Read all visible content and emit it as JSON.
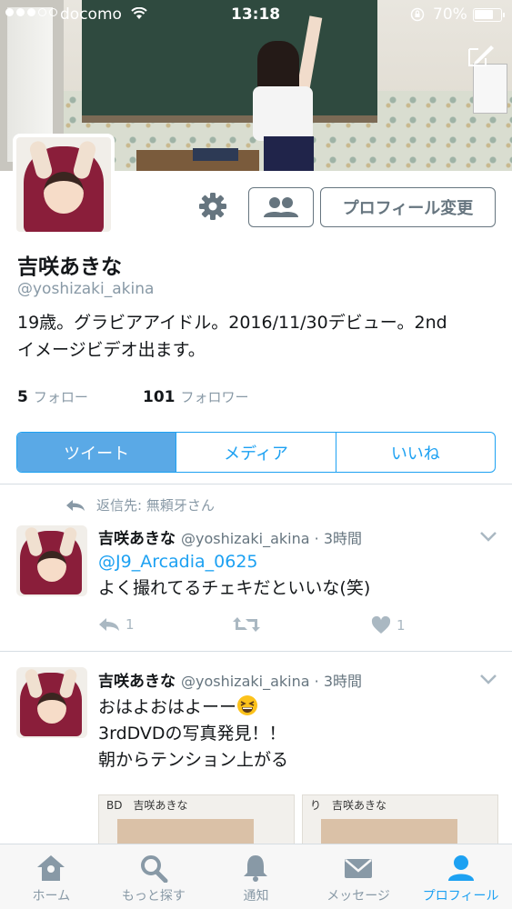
{
  "status_bar": {
    "carrier": "docomo",
    "time": "13:18",
    "battery": "70%"
  },
  "profile": {
    "display_name": "吉咲あきな",
    "handle": "@yoshizaki_akina",
    "bio_line1": "19歳。グラビアアイドル。2016/11/30デビュー。2nd",
    "bio_line2": "イメージビデオ出ます。",
    "following_count": "5",
    "following_label": "フォロー",
    "followers_count": "101",
    "followers_label": "フォロワー",
    "edit_button": "プロフィール変更"
  },
  "tabs": [
    {
      "label": "ツイート",
      "active": true
    },
    {
      "label": "メディア",
      "active": false
    },
    {
      "label": "いいね",
      "active": false
    }
  ],
  "tweets": [
    {
      "reply_context": "返信先: 無頼牙さん",
      "name": "吉咲あきな",
      "meta": "@yoshizaki_akina · 3時間",
      "mention": "@J9_Arcadia_0625",
      "text": "よく撮れてるチェキだといいな(笑)",
      "reply_count": "1",
      "like_count": "1"
    },
    {
      "name": "吉咲あきな",
      "meta": "@yoshizaki_akina · 3時間",
      "line1": "おはよおはよーー",
      "line2": "3rdDVDの写真発見！！",
      "line3": "朝からテンション上がる",
      "media": [
        {
          "caption": "BD　吉咲あきな"
        },
        {
          "caption": "り　吉咲あきな"
        }
      ]
    }
  ],
  "tab_bar": [
    {
      "label": "ホーム",
      "icon": "home-icon",
      "active": false
    },
    {
      "label": "もっと探す",
      "icon": "search-icon",
      "active": false
    },
    {
      "label": "通知",
      "icon": "bell-icon",
      "active": false
    },
    {
      "label": "メッセージ",
      "icon": "envelope-icon",
      "active": false
    },
    {
      "label": "プロフィール",
      "icon": "person-icon",
      "active": true
    }
  ],
  "colors": {
    "accent": "#1da1f2",
    "active_tab_bg": "#5aa9e6",
    "muted": "#8899a6"
  }
}
